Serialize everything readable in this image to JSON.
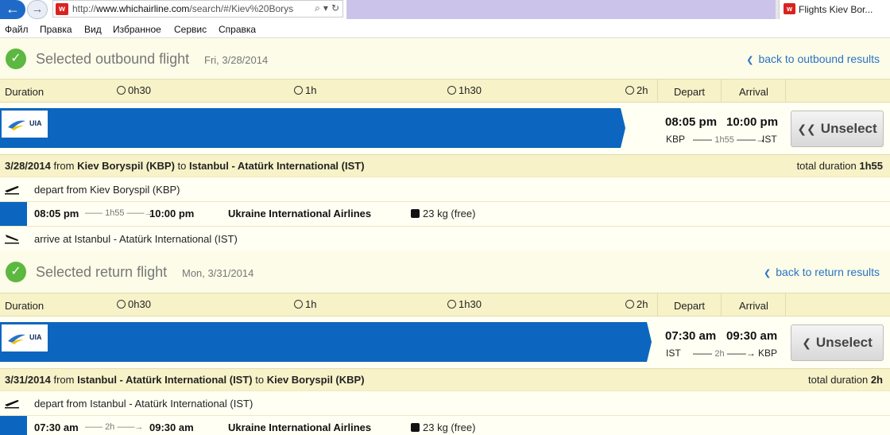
{
  "browser": {
    "url_domain": "www.whichairline.com",
    "url_path": "/search/#/Kiev%20Borys",
    "tab_title": "Flights Kiev Bor...",
    "site_badge": "w"
  },
  "menu": [
    "Файл",
    "Правка",
    "Вид",
    "Избранное",
    "Сервис",
    "Справка"
  ],
  "outbound": {
    "heading": "Selected outbound flight",
    "date": "Fri, 3/28/2014",
    "back_link": "back to outbound results",
    "duration_label": "Duration",
    "ticks": [
      "0h30",
      "1h",
      "1h30",
      "2h"
    ],
    "depart_label": "Depart",
    "arrival_label": "Arrival",
    "airline_logo_text": "UIA",
    "bar_fraction": 0.96,
    "depart_time": "08:05 pm",
    "arrive_time": "10:00 pm",
    "from_code": "KBP",
    "to_code": "IST",
    "leg_duration": "1h55",
    "unselect_label": "Unselect",
    "summary_date": "3/28/2014",
    "summary_from_word": "from",
    "summary_from": "Kiev Boryspil (KBP)",
    "summary_to_word": "to",
    "summary_to": "Istanbul - Atatürk International (IST)",
    "total_label": "total duration",
    "total_value": "1h55",
    "depart_detail": "depart from Kiev Boryspil (KBP)",
    "airline_name": "Ukraine International Airlines",
    "baggage": "23 kg (free)",
    "arrive_detail": "arrive at Istanbul - Atatürk International (IST)"
  },
  "return": {
    "heading": "Selected return flight",
    "date": "Mon, 3/31/2014",
    "back_link": "back to return results",
    "duration_label": "Duration",
    "ticks": [
      "0h30",
      "1h",
      "1h30",
      "2h"
    ],
    "depart_label": "Depart",
    "arrival_label": "Arrival",
    "airline_logo_text": "UIA",
    "bar_fraction": 1.0,
    "depart_time": "07:30 am",
    "arrive_time": "09:30 am",
    "from_code": "IST",
    "to_code": "KBP",
    "leg_duration": "2h",
    "unselect_label": "Unselect",
    "summary_date": "3/31/2014",
    "summary_from_word": "from",
    "summary_from": "Istanbul - Atatürk International (IST)",
    "summary_to_word": "to",
    "summary_to": "Kiev Boryspil (KBP)",
    "total_label": "total duration",
    "total_value": "2h",
    "depart_detail": "depart from Istanbul - Atatürk International (IST)",
    "airline_name": "Ukraine International Airlines",
    "baggage": "23 kg (free)"
  },
  "icons": {
    "check": "check-icon",
    "back_chevron": "chevron-left-icon",
    "clock": "clock-icon",
    "takeoff": "takeoff-icon",
    "landing": "landing-icon",
    "baggage": "baggage-icon",
    "double_chevron": "double-chevron-left-icon",
    "arrow": "arrow-right-icon"
  },
  "colors": {
    "flight_bar": "#0c66c0",
    "check": "#5cb840",
    "link": "#2a73c5",
    "header_band": "#f7f2c8",
    "page_bg": "#fcfce8"
  }
}
